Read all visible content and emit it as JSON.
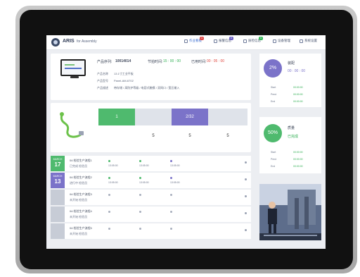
{
  "brand": {
    "name": "ARIS",
    "tagline": "for Assembly"
  },
  "nav": [
    {
      "label": "作业看板",
      "badge": "1",
      "badge_color": "#e04b4b",
      "active": true
    },
    {
      "label": "报警信息",
      "badge": "0",
      "badge_color": "#6c61c6",
      "active": false
    },
    {
      "label": "质检信息",
      "badge": "0",
      "badge_color": "#35b85a",
      "active": false
    },
    {
      "label": "设备管理",
      "badge": "",
      "badge_color": "",
      "active": false
    },
    {
      "label": "系统设置",
      "badge": "",
      "badge_color": "",
      "active": false
    }
  ],
  "product": {
    "serial_label": "产品序列:",
    "serial": "10014014",
    "takt_label": "节拍时间:",
    "takt": "15 : 00 : 00",
    "elapsed_label": "已用时间:",
    "elapsed": "00 : 05 : 00",
    "name_label": "产品名称",
    "name": "13.1寸工业平板",
    "model_label": "产品型号",
    "model": "Panel-AM-6702",
    "desc_label": "产品描述",
    "desc": "带存储 / 高防护等级 / 电容式触摸 / 双网口 / 宽压输入"
  },
  "progress": {
    "current": "1",
    "current_color": "#4fba6e",
    "total": "2/32",
    "total_color": "#7b73c9",
    "counts": [
      "5",
      "5",
      "5"
    ]
  },
  "tasks": [
    {
      "month": "MARCH",
      "day": "17",
      "color": "#4fba6e",
      "title": "04 检验生产流程1",
      "sub": "已完成   检验员",
      "steps": [
        {
          "t": "13:05:00",
          "c": "#4fba6e"
        },
        {
          "t": "13:05:00",
          "c": "#4fba6e"
        },
        {
          "t": "13:05:00",
          "c": "#7b73c9"
        }
      ]
    },
    {
      "month": "MARCH",
      "day": "13",
      "color": "#7b73c9",
      "title": "04 检验生产流程2",
      "sub": "进行中   检验员",
      "steps": [
        {
          "t": "13:05:00",
          "c": "#4fba6e"
        },
        {
          "t": "13:05:00",
          "c": "#4fba6e"
        },
        {
          "t": "13:05:00",
          "c": "#7b73c9"
        }
      ]
    },
    {
      "month": "",
      "day": "",
      "color": "#c7ccd6",
      "title": "04 检验生产流程3",
      "sub": "未开始   检验员",
      "steps": [
        {
          "t": "",
          "c": "#a8afbd"
        },
        {
          "t": "",
          "c": "#a8afbd"
        },
        {
          "t": "",
          "c": "#a8afbd"
        }
      ]
    },
    {
      "month": "",
      "day": "",
      "color": "#c7ccd6",
      "title": "04 检验生产流程4",
      "sub": "未开始   检验员",
      "steps": [
        {
          "t": "",
          "c": "#a8afbd"
        },
        {
          "t": "",
          "c": "#a8afbd"
        },
        {
          "t": "",
          "c": "#a8afbd"
        }
      ]
    },
    {
      "month": "",
      "day": "",
      "color": "#c7ccd6",
      "title": "04 检验生产流程5",
      "sub": "未开始   检验员",
      "steps": [
        {
          "t": "",
          "c": "#a8afbd"
        },
        {
          "t": "",
          "c": "#a8afbd"
        },
        {
          "t": "",
          "c": "#a8afbd"
        }
      ]
    }
  ],
  "side_top": {
    "ring": "2%",
    "ring_color": "#7b73c9",
    "title": "装配",
    "time": "00 : 00 : 00",
    "rows": [
      {
        "label": "Start",
        "value": "00:00:00"
      },
      {
        "label": "Pend",
        "value": "00:00:00"
      },
      {
        "label": "End",
        "value": "00:00:00"
      }
    ]
  },
  "side_mid": {
    "ring": "50%",
    "ring_color": "#4fba6e",
    "title": "质量",
    "status": "已完成",
    "rows": [
      {
        "label": "Start",
        "value": "00:00:00"
      },
      {
        "label": "Pend",
        "value": "00:00:00"
      },
      {
        "label": "End",
        "value": "00:00:00"
      }
    ]
  },
  "icons": {
    "logo": "logo-icon",
    "nav": "menu-icon",
    "cable": "cable-icon",
    "monitor": "monitor-icon"
  }
}
